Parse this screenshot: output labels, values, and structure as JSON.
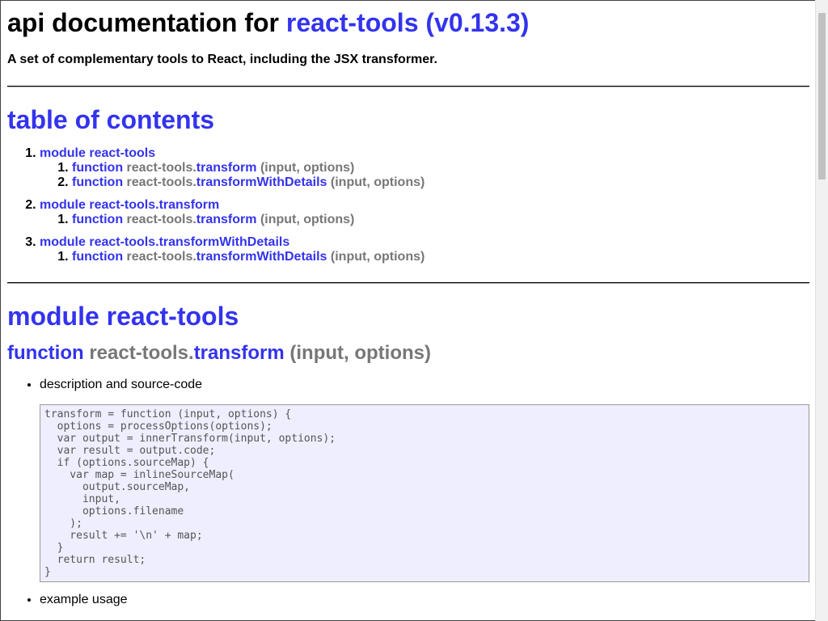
{
  "header": {
    "title_prefix": "api documentation for",
    "title_pkg": "react-tools (v0.13.3)",
    "subtitle": "A set of complementary tools to React, including the JSX transformer."
  },
  "toc": {
    "heading": "table of contents",
    "modules": [
      {
        "label": "module react-tools",
        "functions": [
          {
            "kw": "function",
            "prefix": "react-tools.",
            "name": "transform",
            "args": "(input, options)"
          },
          {
            "kw": "function",
            "prefix": "react-tools.",
            "name": "transformWithDetails",
            "args": "(input, options)"
          }
        ]
      },
      {
        "label": "module react-tools.transform",
        "functions": [
          {
            "kw": "function",
            "prefix": "react-tools.",
            "name": "transform",
            "args": "(input, options)"
          }
        ]
      },
      {
        "label": "module react-tools.transformWithDetails",
        "functions": [
          {
            "kw": "function",
            "prefix": "react-tools.",
            "name": "transformWithDetails",
            "args": "(input, options)"
          }
        ]
      }
    ]
  },
  "module_section": {
    "heading": "module react-tools",
    "function": {
      "kw": "function",
      "prefix": "react-tools.",
      "name": "transform",
      "args": "(input, options)"
    },
    "bullets": [
      "description and source-code",
      "example usage"
    ],
    "code": "transform = function (input, options) {\n  options = processOptions(options);\n  var output = innerTransform(input, options);\n  var result = output.code;\n  if (options.sourceMap) {\n    var map = inlineSourceMap(\n      output.sourceMap,\n      input,\n      options.filename\n    );\n    result += '\\n' + map;\n  }\n  return result;\n}"
  }
}
